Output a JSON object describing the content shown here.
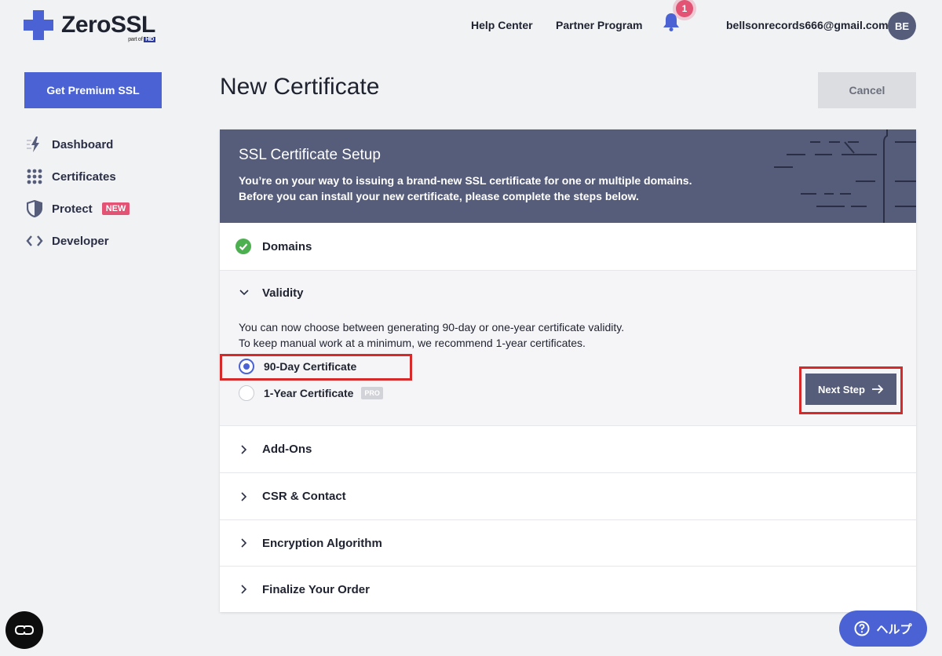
{
  "header": {
    "logo_text": "ZeroSSL",
    "logo_sub": "part of",
    "logo_sub_brand": "HID",
    "nav": [
      "Help Center",
      "Partner Program"
    ],
    "notification_count": "1",
    "user_email": "bellsonrecords666@gmail.com",
    "avatar_initials": "BE"
  },
  "sidebar": {
    "premium_button": "Get Premium SSL",
    "items": [
      {
        "label": "Dashboard",
        "icon": "lightning-icon"
      },
      {
        "label": "Certificates",
        "icon": "grid-dots-icon"
      },
      {
        "label": "Protect",
        "icon": "shield-icon",
        "badge": "NEW"
      },
      {
        "label": "Developer",
        "icon": "code-brackets-icon"
      }
    ]
  },
  "main": {
    "title": "New Certificate",
    "cancel_button": "Cancel",
    "card": {
      "title": "SSL Certificate Setup",
      "intro_line1": "You’re on your way to issuing a brand-new SSL certificate for one or multiple domains.",
      "intro_line2": "Before you can install your new certificate, please complete the steps below.",
      "steps": {
        "domains": "Domains",
        "validity": "Validity",
        "addons": "Add-Ons",
        "csr": "CSR & Contact",
        "encryption": "Encryption Algorithm",
        "finalize": "Finalize Your Order"
      },
      "validity": {
        "desc_line1": "You can now choose between generating 90-day or one-year certificate validity.",
        "desc_line2": "To keep manual work at a minimum, we recommend 1-year certificates.",
        "option_90": "90-Day Certificate",
        "option_1y": "1-Year Certificate",
        "pro_badge": "PRO",
        "selected": "90-Day Certificate",
        "next_button": "Next Step"
      }
    }
  },
  "floating": {
    "help_label": "ヘルプ"
  },
  "colors": {
    "accent": "#4a62d4",
    "header_band": "#565d7a",
    "badge": "#e25374",
    "highlight": "#d62a2a",
    "success": "#4caf50"
  }
}
